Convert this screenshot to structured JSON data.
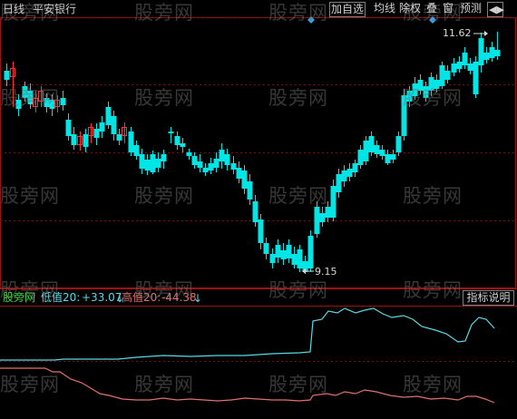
{
  "header": {
    "period_label": "日线",
    "stock_name": "平安银行",
    "menu": [
      "加自选",
      "均线",
      "除权",
      "叠",
      "窗",
      "预测"
    ],
    "arrow_icon": "double-arrow-icon"
  },
  "price_panel": {
    "high_label": "11.62",
    "low_label": "9.15",
    "high_arrow_icon": "arrow-right-icon",
    "low_arrow_icon": "arrow-left-icon",
    "event_marker_icon": "diamond-icon",
    "up_color": "#ff3232",
    "down_color": "#00e5e5"
  },
  "indicator": {
    "name": "股旁网",
    "low_label": "低值20:",
    "low_value": "+33.07",
    "low_arrow": "↓",
    "high_label": "高值20:",
    "high_value": "-44.38",
    "high_arrow": "↓",
    "explain_button": "指标说明",
    "low_color": "#5ad8e6",
    "high_color": "#e07070"
  },
  "watermark": "股旁网"
}
